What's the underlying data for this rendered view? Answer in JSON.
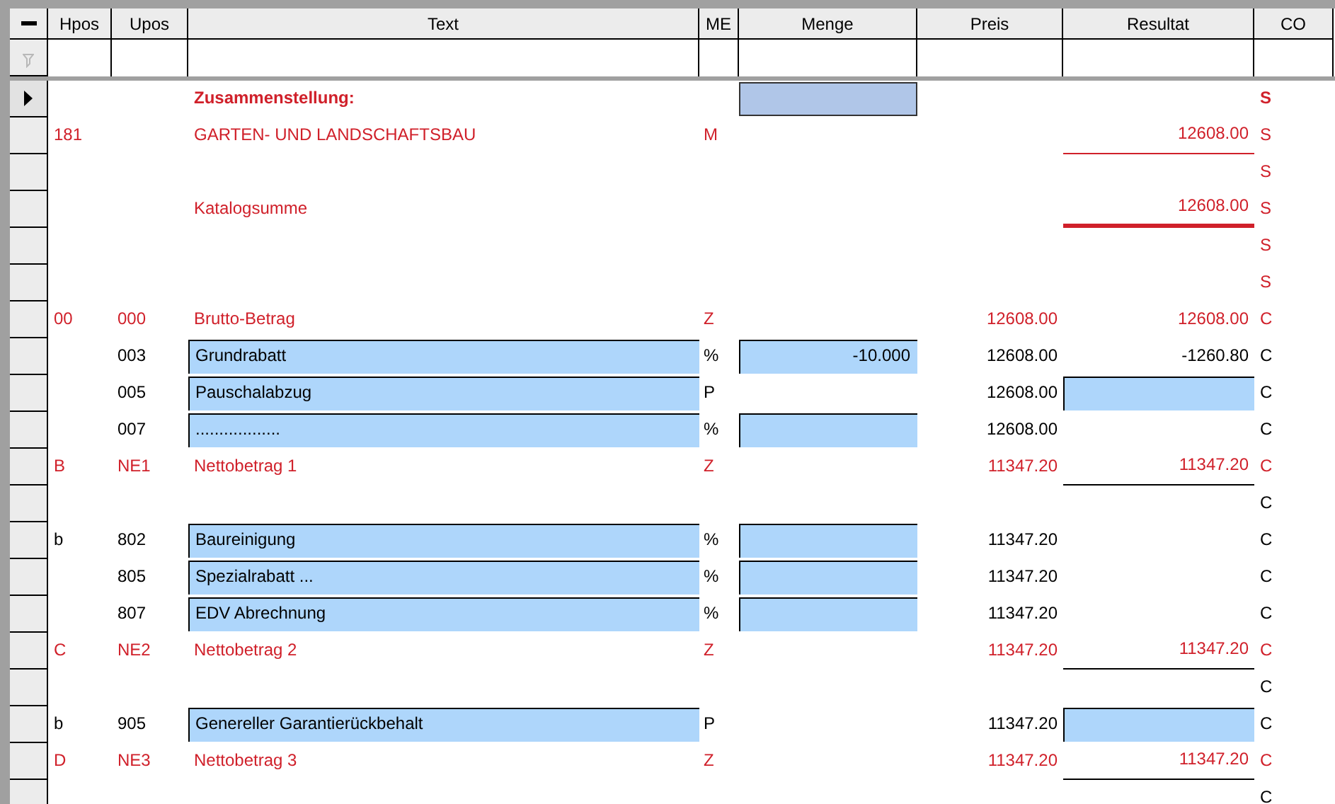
{
  "columns": [
    "Hpos",
    "Upos",
    "Text",
    "ME",
    "Menge",
    "Preis",
    "Resultat",
    "CO"
  ],
  "rows": [
    {
      "kind": "heading",
      "selected": true,
      "hpos": "",
      "upos": "",
      "text": "Zusammenstellung:",
      "text_field": false,
      "me": "",
      "menge": "",
      "menge_field": true,
      "preis": "",
      "resultat": "",
      "result_field": false,
      "co": "S"
    },
    {
      "kind": "total",
      "selected": false,
      "hpos": "181",
      "upos": "",
      "text": "GARTEN- UND LANDSCHAFTSBAU",
      "text_field": false,
      "me": "M",
      "menge": "",
      "menge_field": false,
      "preis": "",
      "resultat": "12608.00",
      "result_field": false,
      "co": "S",
      "rule": {
        "bold": false,
        "color": "#d0202a"
      }
    },
    {
      "kind": "total",
      "selected": false,
      "hpos": "",
      "upos": "",
      "text": "",
      "text_field": false,
      "me": "",
      "menge": "",
      "menge_field": false,
      "preis": "",
      "resultat": "",
      "result_field": false,
      "co": "S"
    },
    {
      "kind": "total",
      "selected": false,
      "hpos": "",
      "upos": "",
      "text": "Katalogsumme",
      "text_field": false,
      "me": "",
      "menge": "",
      "menge_field": false,
      "preis": "",
      "resultat": "12608.00",
      "result_field": false,
      "co": "S",
      "rule": {
        "bold": true,
        "color": "#d0202a"
      }
    },
    {
      "kind": "total",
      "selected": false,
      "hpos": "",
      "upos": "",
      "text": "",
      "text_field": false,
      "me": "",
      "menge": "",
      "menge_field": false,
      "preis": "",
      "resultat": "",
      "result_field": false,
      "co": "S"
    },
    {
      "kind": "total",
      "selected": false,
      "hpos": "",
      "upos": "",
      "text": "",
      "text_field": false,
      "me": "",
      "menge": "",
      "menge_field": false,
      "preis": "",
      "resultat": "",
      "result_field": false,
      "co": "S"
    },
    {
      "kind": "total",
      "selected": false,
      "hpos": "00",
      "upos": "000",
      "text": "Brutto-Betrag",
      "text_field": false,
      "me": "Z",
      "menge": "",
      "menge_field": false,
      "preis": "12608.00",
      "resultat": "12608.00",
      "result_field": false,
      "co": "C"
    },
    {
      "kind": "item",
      "selected": false,
      "hpos": "",
      "upos": "003",
      "text": "Grundrabatt",
      "text_field": true,
      "me": "%",
      "menge": "-10.000",
      "menge_field": true,
      "preis": "12608.00",
      "resultat": "-1260.80",
      "result_field": false,
      "co": "C"
    },
    {
      "kind": "item",
      "selected": false,
      "hpos": "",
      "upos": "005",
      "text": "Pauschalabzug",
      "text_field": true,
      "me": "P",
      "menge": "",
      "menge_field": false,
      "preis": "12608.00",
      "resultat": "",
      "result_field": true,
      "co": "C"
    },
    {
      "kind": "item",
      "selected": false,
      "hpos": "",
      "upos": "007",
      "text": "..................",
      "text_field": true,
      "me": "%",
      "menge": "",
      "menge_field": true,
      "preis": "12608.00",
      "resultat": "",
      "result_field": false,
      "co": "C"
    },
    {
      "kind": "total",
      "selected": false,
      "hpos": "B",
      "upos": "NE1",
      "text": "Nettobetrag 1",
      "text_field": false,
      "me": "Z",
      "menge": "",
      "menge_field": false,
      "preis": "11347.20",
      "resultat": "11347.20",
      "result_field": false,
      "co": "C",
      "rule": {
        "bold": false,
        "color": "#000000"
      }
    },
    {
      "kind": "item",
      "selected": false,
      "hpos": "",
      "upos": "",
      "text": "",
      "text_field": false,
      "me": "",
      "menge": "",
      "menge_field": false,
      "preis": "",
      "resultat": "",
      "result_field": false,
      "co": "C"
    },
    {
      "kind": "item",
      "selected": false,
      "hpos": "b",
      "upos": "802",
      "text": "Baureinigung",
      "text_field": true,
      "me": "%",
      "menge": "",
      "menge_field": true,
      "preis": "11347.20",
      "resultat": "",
      "result_field": false,
      "co": "C"
    },
    {
      "kind": "item",
      "selected": false,
      "hpos": "",
      "upos": "805",
      "text": "Spezialrabatt ...",
      "text_field": true,
      "me": "%",
      "menge": "",
      "menge_field": true,
      "preis": "11347.20",
      "resultat": "",
      "result_field": false,
      "co": "C"
    },
    {
      "kind": "item",
      "selected": false,
      "hpos": "",
      "upos": "807",
      "text": "EDV Abrechnung",
      "text_field": true,
      "me": "%",
      "menge": "",
      "menge_field": true,
      "preis": "11347.20",
      "resultat": "",
      "result_field": false,
      "co": "C"
    },
    {
      "kind": "total",
      "selected": false,
      "hpos": "C",
      "upos": "NE2",
      "text": "Nettobetrag 2",
      "text_field": false,
      "me": "Z",
      "menge": "",
      "menge_field": false,
      "preis": "11347.20",
      "resultat": "11347.20",
      "result_field": false,
      "co": "C",
      "rule": {
        "bold": false,
        "color": "#000000"
      }
    },
    {
      "kind": "item",
      "selected": false,
      "hpos": "",
      "upos": "",
      "text": "",
      "text_field": false,
      "me": "",
      "menge": "",
      "menge_field": false,
      "preis": "",
      "resultat": "",
      "result_field": false,
      "co": "C"
    },
    {
      "kind": "item",
      "selected": false,
      "hpos": "b",
      "upos": "905",
      "text": "Genereller Garantierückbehalt",
      "text_field": true,
      "me": "P",
      "menge": "",
      "menge_field": false,
      "preis": "11347.20",
      "resultat": "",
      "result_field": true,
      "co": "C"
    },
    {
      "kind": "total",
      "selected": false,
      "hpos": "D",
      "upos": "NE3",
      "text": "Nettobetrag 3",
      "text_field": false,
      "me": "Z",
      "menge": "",
      "menge_field": false,
      "preis": "11347.20",
      "resultat": "11347.20",
      "result_field": false,
      "co": "C",
      "rule": {
        "bold": false,
        "color": "#000000"
      }
    },
    {
      "kind": "item",
      "selected": false,
      "hpos": "",
      "upos": "",
      "text": "",
      "text_field": false,
      "me": "",
      "menge": "",
      "menge_field": false,
      "preis": "",
      "resultat": "",
      "result_field": false,
      "co": "C"
    }
  ]
}
